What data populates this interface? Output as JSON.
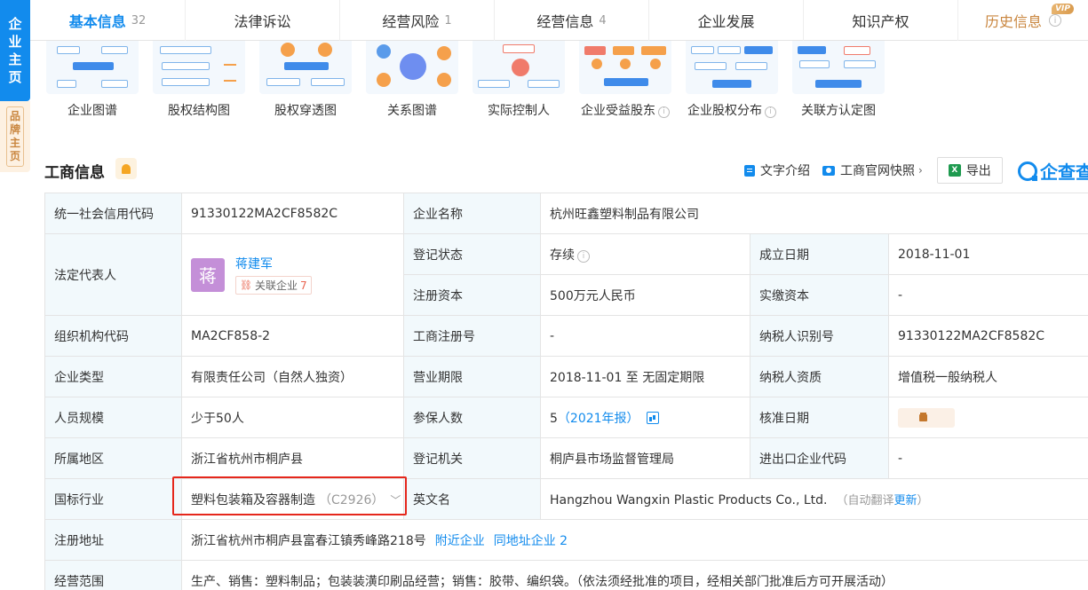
{
  "side": {
    "tab1": [
      "企",
      "业",
      "主",
      "页"
    ],
    "tab2": [
      "品",
      "牌",
      "主",
      "页"
    ]
  },
  "tabs": [
    {
      "label": "基本信息",
      "count": "32",
      "active": true
    },
    {
      "label": "法律诉讼",
      "count": ""
    },
    {
      "label": "经营风险",
      "count": "1"
    },
    {
      "label": "经营信息",
      "count": "4"
    },
    {
      "label": "企业发展",
      "count": ""
    },
    {
      "label": "知识产权",
      "count": ""
    },
    {
      "label": "历史信息",
      "count": "",
      "vip": "VIP"
    }
  ],
  "graphs": [
    "企业图谱",
    "股权结构图",
    "股权穿透图",
    "关系图谱",
    "实际控制人",
    "企业受益股东",
    "企业股权分布",
    "关联方认定图"
  ],
  "section": {
    "title": "工商信息",
    "text_intro": "文字介绍",
    "snapshot": "工商官网快照",
    "export": "导出",
    "export_icon": "X",
    "brand": "企查查"
  },
  "company": {
    "credit_code_label": "统一社会信用代码",
    "credit_code": "91330122MA2CF8582C",
    "name_label": "企业名称",
    "name": "杭州旺鑫塑料制品有限公司",
    "legal_rep_label": "法定代表人",
    "legal_rep_avatar": "蒋",
    "legal_rep": "蒋建军",
    "related_label": "关联企业",
    "related_count": "7",
    "status_label": "登记状态",
    "status": "存续",
    "founded_label": "成立日期",
    "founded": "2018-11-01",
    "reg_capital_label": "注册资本",
    "reg_capital": "500万元人民币",
    "paid_capital_label": "实缴资本",
    "paid_capital": "-",
    "org_code_label": "组织机构代码",
    "org_code": "MA2CF858-2",
    "reg_no_label": "工商注册号",
    "reg_no": "-",
    "taxpayer_id_label": "纳税人识别号",
    "taxpayer_id": "91330122MA2CF8582C",
    "type_label": "企业类型",
    "type": "有限责任公司（自然人独资）",
    "term_label": "营业期限",
    "term": "2018-11-01 至 无固定期限",
    "taxpayer_qual_label": "纳税人资质",
    "taxpayer_qual": "增值税一般纳税人",
    "staff_label": "人员规模",
    "staff": "少于50人",
    "insured_label": "参保人数",
    "insured": "5",
    "insured_year": "（2021年报）",
    "approved_label": "核准日期",
    "region_label": "所属地区",
    "region": "浙江省杭州市桐庐县",
    "authority_label": "登记机关",
    "authority": "桐庐县市场监督管理局",
    "ie_code_label": "进出口企业代码",
    "ie_code": "-",
    "industry_label": "国标行业",
    "industry": "塑料包装箱及容器制造",
    "industry_code": "（C2926）",
    "en_name_label": "英文名",
    "en_name": "Hangzhou Wangxin Plastic Products Co., Ltd.",
    "en_note_prefix": "（自动翻译",
    "en_note_link": "更新",
    "en_note_suffix": "）",
    "address_label": "注册地址",
    "address": "浙江省杭州市桐庐县富春江镇秀峰路218号",
    "nearby": "附近企业",
    "same_addr": "同地址企业 2",
    "scope_label": "经营范围",
    "scope": "生产、销售：塑料制品；包装装潢印刷品经营；销售：胶带、编织袋。（依法须经批准的项目，经相关部门批准后方可开展活动）"
  },
  "colors": {
    "accent": "#128bed",
    "highlight_border": "#e5271c",
    "label_bg": "#f2f9fc"
  }
}
